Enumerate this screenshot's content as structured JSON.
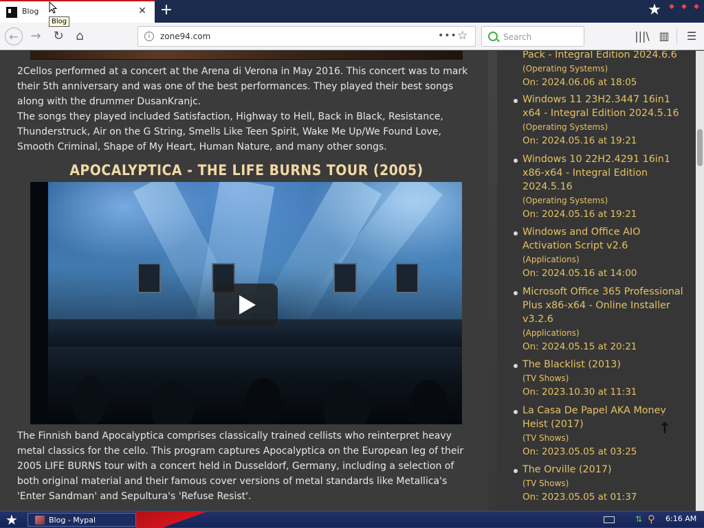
{
  "browser": {
    "tab": {
      "title": "Blog",
      "tooltip": "Blog",
      "close_icon": "close-icon"
    },
    "new_tab_label": "+",
    "address": {
      "url": "zone94.com"
    },
    "search": {
      "placeholder": "Search"
    }
  },
  "article": {
    "paragraph_1": "2Cellos performed at a concert at the Arena di Verona in May 2016. This concert was to mark their 5th anniversary and was one of the best performances. They played their best songs along with the drummer DusanKranjc.",
    "paragraph_1b": "The songs they played included Satisfaction, Highway to Hell, Back in Black, Resistance, Thunderstruck, Air on the G String, Smells Like Teen Spirit, Wake Me Up/We Found Love, Smooth Criminal, Shape of My Heart, Human Nature, and many other songs.",
    "section_title": "APOCALYPTICA - THE LIFE BURNS TOUR (2005)",
    "paragraph_2": "The Finnish band Apocalyptica comprises classically trained cellists who reinterpret heavy metal classics for the cello. This program captures Apocalyptica on the European leg of their 2005 LIFE BURNS tour with a concert held in Dusseldorf, Germany, including a selection of both original material and their famous cover versions of metal standards like Metallica's 'Enter Sandman' and Sepultura's 'Refuse Resist'."
  },
  "sidebar": {
    "partial_post_title": "Pack - Integral Edition 2024.6.6",
    "partial_post_category": "(Operating Systems)",
    "partial_post_date": "On: 2024.06.06 at 18:05",
    "posts": [
      {
        "title": "Windows 11 23H2.3447 16in1 x64 - Integral Edition 2024.5.16",
        "category": "(Operating Systems)",
        "date": "On: 2024.05.16 at 19:21"
      },
      {
        "title": "Windows 10 22H2.4291 16in1 x86-x64 - Integral Edition 2024.5.16",
        "category": "(Operating Systems)",
        "date": "On: 2024.05.16 at 19:21"
      },
      {
        "title": "Windows and Office AIO Activation Script v2.6",
        "category": "(Applications)",
        "date": "On: 2024.05.16 at 14:00"
      },
      {
        "title": "Microsoft Office 365 Professional Plus x86-x64 - Online Installer v3.2.6",
        "category": "(Applications)",
        "date": "On: 2024.05.15 at 20:21"
      },
      {
        "title": "The Blacklist (2013)",
        "category": "(TV Shows)",
        "date": "On: 2023.10.30 at 11:31"
      },
      {
        "title": "La Casa De Papel AKA Money Heist (2017)",
        "category": "(TV Shows)",
        "date": "On: 2023.05.05 at 03:25"
      },
      {
        "title": "The Orville (2017)",
        "category": "(TV Shows)",
        "date": "On: 2023.05.05 at 01:37"
      }
    ]
  },
  "taskbar": {
    "task_label": "Blog - Mypal",
    "clock": "6:16 AM"
  },
  "colors": {
    "accent_link": "#e6c265",
    "heading": "#f1d9a5",
    "tab_indicator": "#c0181d"
  }
}
